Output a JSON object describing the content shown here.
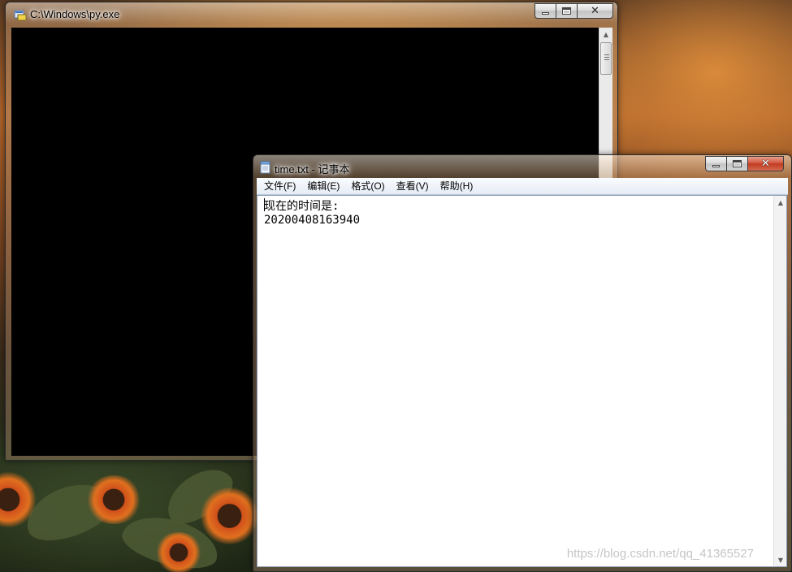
{
  "console_window": {
    "title": "C:\\Windows\\py.exe",
    "icon": "console-app-icon"
  },
  "notepad_window": {
    "title": "time.txt - 记事本",
    "icon": "notepad-icon",
    "menu": [
      "文件(F)",
      "编辑(E)",
      "格式(O)",
      "查看(V)",
      "帮助(H)"
    ],
    "content_lines": [
      "现在的时间是:",
      "20200408163940"
    ]
  },
  "caption_buttons": {
    "minimize_icon": "minimize-icon",
    "maximize_icon": "maximize-icon",
    "close_icon": "close-icon",
    "close_glyph": "✕"
  },
  "watermark": "https://blog.csdn.net/qq_41365527",
  "colors": {
    "console_background": "#000000",
    "close_button": "#c23b21",
    "editor_background": "#ffffff"
  }
}
